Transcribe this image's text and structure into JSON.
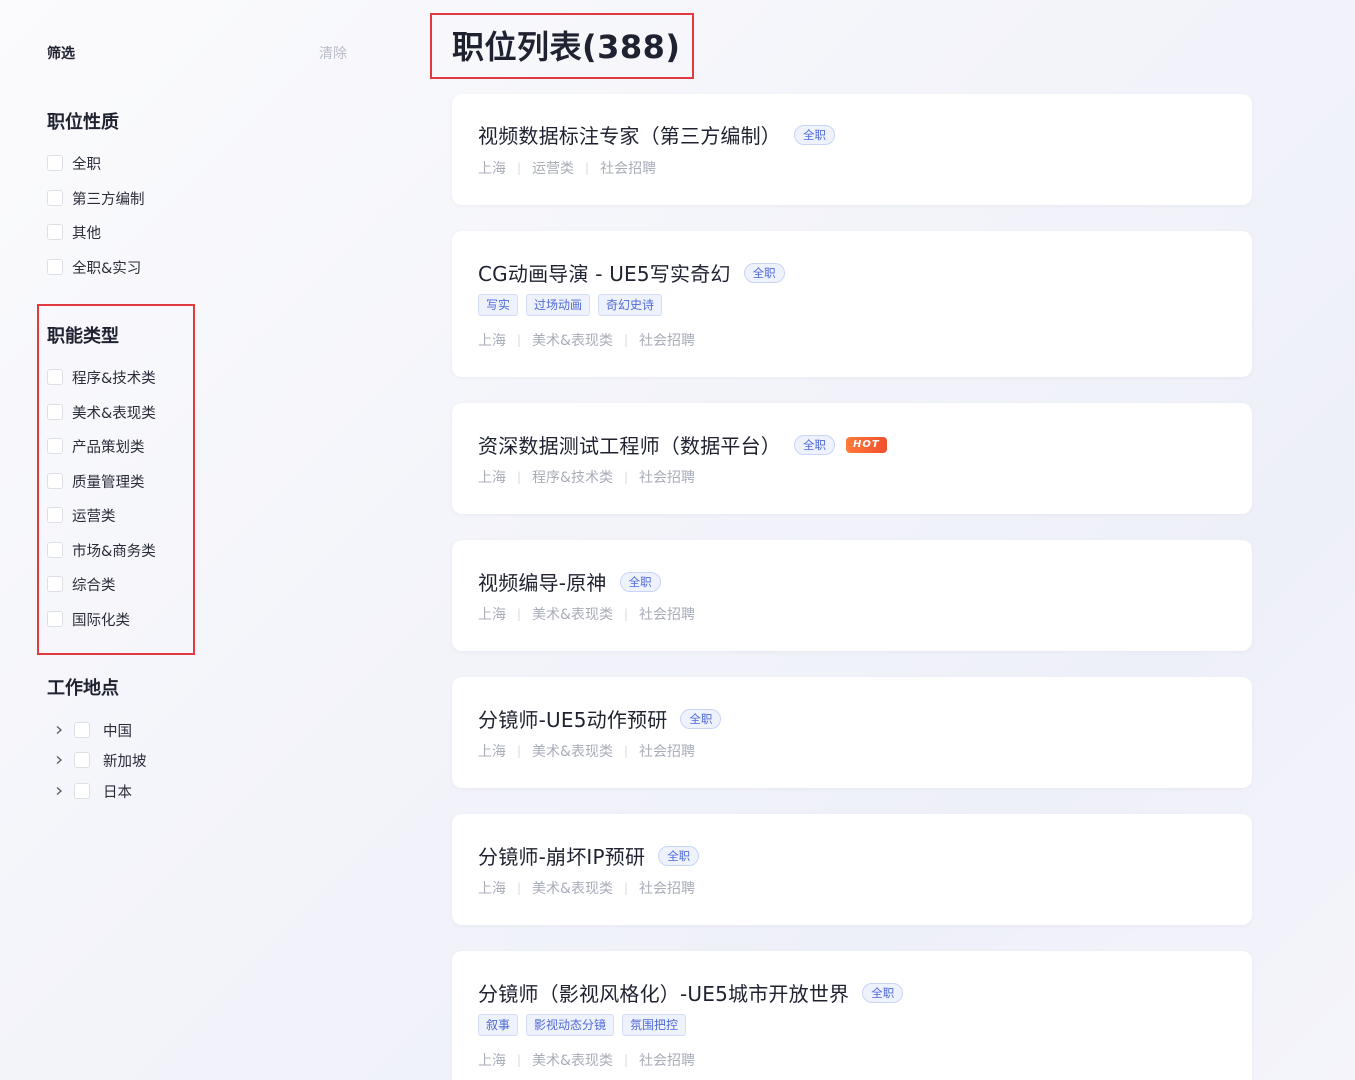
{
  "filter": {
    "title": "筛选",
    "clear_label": "清除"
  },
  "job_nature": {
    "title": "职位性质",
    "options": [
      "全职",
      "第三方编制",
      "其他",
      "全职&实习"
    ]
  },
  "job_category": {
    "title": "职能类型",
    "options": [
      "程序&技术类",
      "美术&表现类",
      "产品策划类",
      "质量管理类",
      "运营类",
      "市场&商务类",
      "综合类",
      "国际化类"
    ]
  },
  "location": {
    "title": "工作地点",
    "options": [
      "中国",
      "新加坡",
      "日本"
    ]
  },
  "main": {
    "title": "职位列表(388)"
  },
  "jobs": [
    {
      "title": "视频数据标注专家（第三方编制）",
      "badge": "全职",
      "tags": [],
      "city": "上海",
      "category": "运营类",
      "recruit": "社会招聘"
    },
    {
      "title": "CG动画导演 - UE5写实奇幻",
      "badge": "全职",
      "tags": [
        "写实",
        "过场动画",
        "奇幻史诗"
      ],
      "city": "上海",
      "category": "美术&表现类",
      "recruit": "社会招聘"
    },
    {
      "title": "资深数据测试工程师（数据平台）",
      "badge": "全职",
      "hot": "HOT",
      "tags": [],
      "city": "上海",
      "category": "程序&技术类",
      "recruit": "社会招聘"
    },
    {
      "title": "视频编导-原神",
      "badge": "全职",
      "tags": [],
      "city": "上海",
      "category": "美术&表现类",
      "recruit": "社会招聘"
    },
    {
      "title": "分镜师-UE5动作预研",
      "badge": "全职",
      "tags": [],
      "city": "上海",
      "category": "美术&表现类",
      "recruit": "社会招聘"
    },
    {
      "title": "分镜师-崩坏IP预研",
      "badge": "全职",
      "tags": [],
      "city": "上海",
      "category": "美术&表现类",
      "recruit": "社会招聘"
    },
    {
      "title": "分镜师（影视风格化）-UE5城市开放世界",
      "badge": "全职",
      "tags": [
        "叙事",
        "影视动态分镜",
        "氛围把控"
      ],
      "city": "上海",
      "category": "美术&表现类",
      "recruit": "社会招聘"
    }
  ],
  "colors": {
    "accent": "#4f6ad8",
    "highlight_box": "#e0393e",
    "hot_badge": "#f04f2e"
  },
  "icons": {
    "expand": "chevron-right-icon"
  }
}
